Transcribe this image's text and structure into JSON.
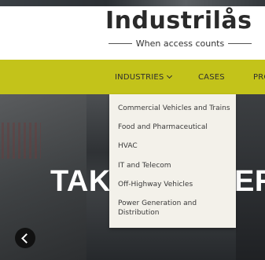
{
  "brand": {
    "logo": "Industrilås",
    "tagline": "When access counts"
  },
  "nav": {
    "items": [
      {
        "label": "INDUSTRIES",
        "has_dropdown": true
      },
      {
        "label": "CASES"
      },
      {
        "label": "PRO"
      }
    ]
  },
  "dropdown": {
    "items": [
      {
        "label": "Commercial Vehicles and Trains"
      },
      {
        "label": "Food and Pharmaceutical"
      },
      {
        "label": "HVAC"
      },
      {
        "label": "IT and Telecom"
      },
      {
        "label": "Off-Highway Vehicles"
      },
      {
        "label": "Power Generation and Distribution"
      }
    ]
  },
  "hero": {
    "headline_left": "TAK",
    "headline_right": "ER",
    "prev_icon": "chevron-left-icon"
  },
  "colors": {
    "nav_background": "#c3c31a",
    "dropdown_background": "#f3f1ea",
    "hero_text": "#ffffff"
  }
}
